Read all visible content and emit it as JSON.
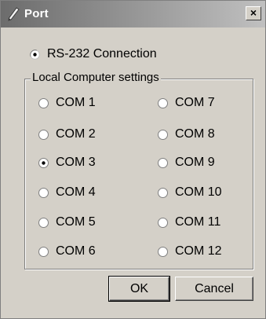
{
  "window": {
    "title": "Port",
    "close_label": "×"
  },
  "connection": {
    "label": "RS-232 Connection",
    "selected": true
  },
  "group": {
    "legend": "Local Computer settings"
  },
  "ports_left": [
    {
      "label": "COM 1",
      "selected": false
    },
    {
      "label": "COM 2",
      "selected": false
    },
    {
      "label": "COM 3",
      "selected": true
    },
    {
      "label": "COM 4",
      "selected": false
    },
    {
      "label": "COM 5",
      "selected": false
    },
    {
      "label": "COM 6",
      "selected": false
    }
  ],
  "ports_right": [
    {
      "label": "COM 7",
      "selected": false
    },
    {
      "label": "COM 8",
      "selected": false
    },
    {
      "label": "COM 9",
      "selected": false
    },
    {
      "label": "COM 10",
      "selected": false
    },
    {
      "label": "COM 11",
      "selected": false
    },
    {
      "label": "COM 12",
      "selected": false
    }
  ],
  "buttons": {
    "ok": "OK",
    "cancel": "Cancel"
  },
  "colors": {
    "dialog_bg": "#d4d0c8",
    "title_gradient_start": "#6c6c6c",
    "title_gradient_end": "#c0c0c0"
  }
}
